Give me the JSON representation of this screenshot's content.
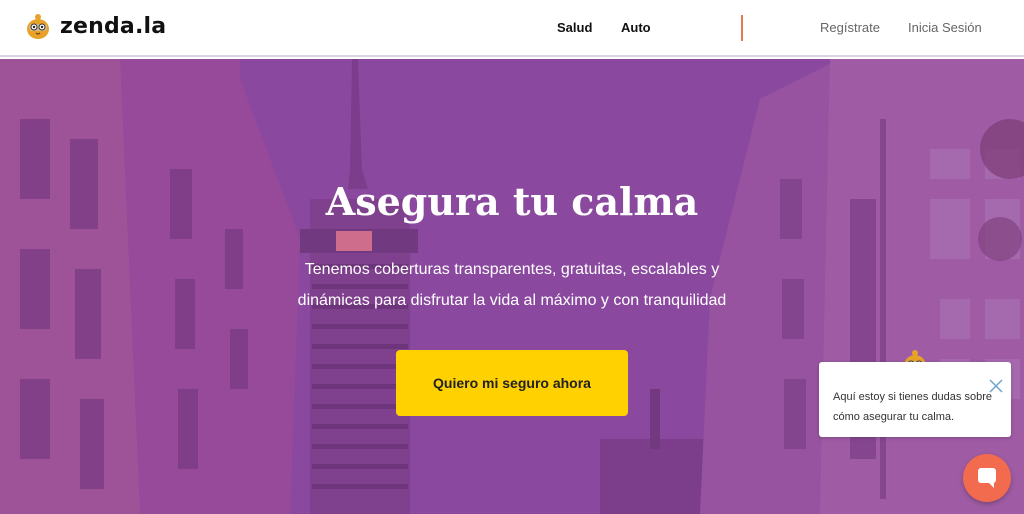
{
  "brand": {
    "name": "zenda.la",
    "logo_icon": "owl-icon",
    "accent": "#e8a227"
  },
  "nav": {
    "items": [
      {
        "label": "Salud"
      },
      {
        "label": "Auto"
      }
    ],
    "divider_color": "#e07a52"
  },
  "auth": {
    "register_label": "Regístrate",
    "login_label": "Inicia Sesión"
  },
  "hero": {
    "title": "Asegura tu calma",
    "subtitle": "Tenemos coberturas transparentes, gratuitas, escalables y dinámicas para disfrutar la vida al máximo y con tranquilidad",
    "cta_label": "Quiero mi seguro ahora",
    "cta_color": "#ffd100",
    "overlay_color": "#8a4aa0"
  },
  "chat": {
    "message": "Aquí estoy si tienes dudas sobre cómo asegurar tu calma.",
    "close_icon": "close-icon",
    "launcher_icon": "chat-bubble-icon",
    "launcher_color": "#f26b4f"
  }
}
